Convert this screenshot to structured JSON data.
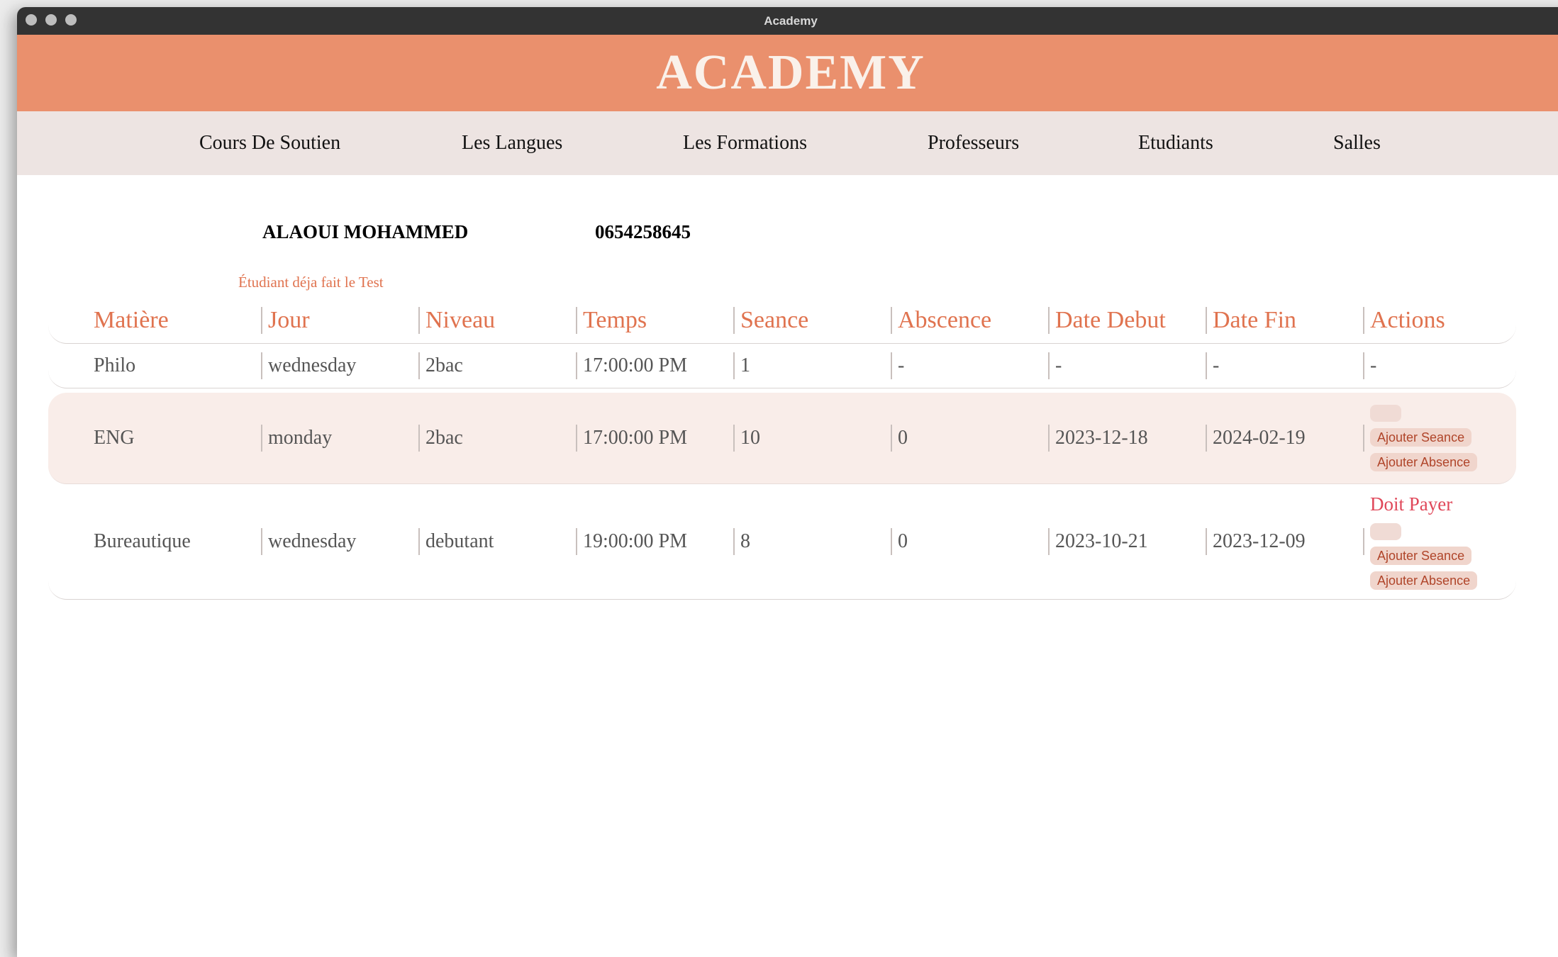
{
  "window": {
    "title": "Academy"
  },
  "header": {
    "logo": "ACADEMY"
  },
  "nav": {
    "items": [
      "Cours De Soutien",
      "Les Langues",
      "Les Formations",
      "Professeurs",
      "Etudiants",
      "Salles"
    ]
  },
  "student": {
    "name": "ALAOUI MOHAMMED",
    "phone": "0654258645",
    "test_note": "Étudiant déja fait le Test"
  },
  "table": {
    "columns": [
      "Matière",
      "Jour",
      "Niveau",
      "Temps",
      "Seance",
      "Abscence",
      "Date Debut",
      "Date Fin",
      "Actions"
    ],
    "rows": [
      {
        "matiere": "Philo",
        "jour": "wednesday",
        "niveau": "2bac",
        "temps": "17:00:00 PM",
        "seance": "1",
        "abscence": "-",
        "date_debut": "-",
        "date_fin": "-",
        "actions_text": "-"
      },
      {
        "matiere": "ENG",
        "jour": "monday",
        "niveau": "2bac",
        "temps": "17:00:00 PM",
        "seance": "10",
        "abscence": "0",
        "date_debut": "2023-12-18",
        "date_fin": "2024-02-19",
        "ajouter_seance": "Ajouter Seance",
        "ajouter_absence": "Ajouter Absence"
      },
      {
        "matiere": "Bureautique",
        "jour": "wednesday",
        "niveau": "debutant",
        "temps": "19:00:00 PM",
        "seance": "8",
        "abscence": "0",
        "date_debut": "2023-10-21",
        "date_fin": "2023-12-09",
        "status": "Doit Payer",
        "ajouter_seance": "Ajouter Seance",
        "ajouter_absence": "Ajouter Absence"
      }
    ]
  },
  "colors": {
    "banner": "#ea906d",
    "accent": "#e0734f",
    "nav_bg": "#ede4e2",
    "warning": "#e0485a"
  }
}
